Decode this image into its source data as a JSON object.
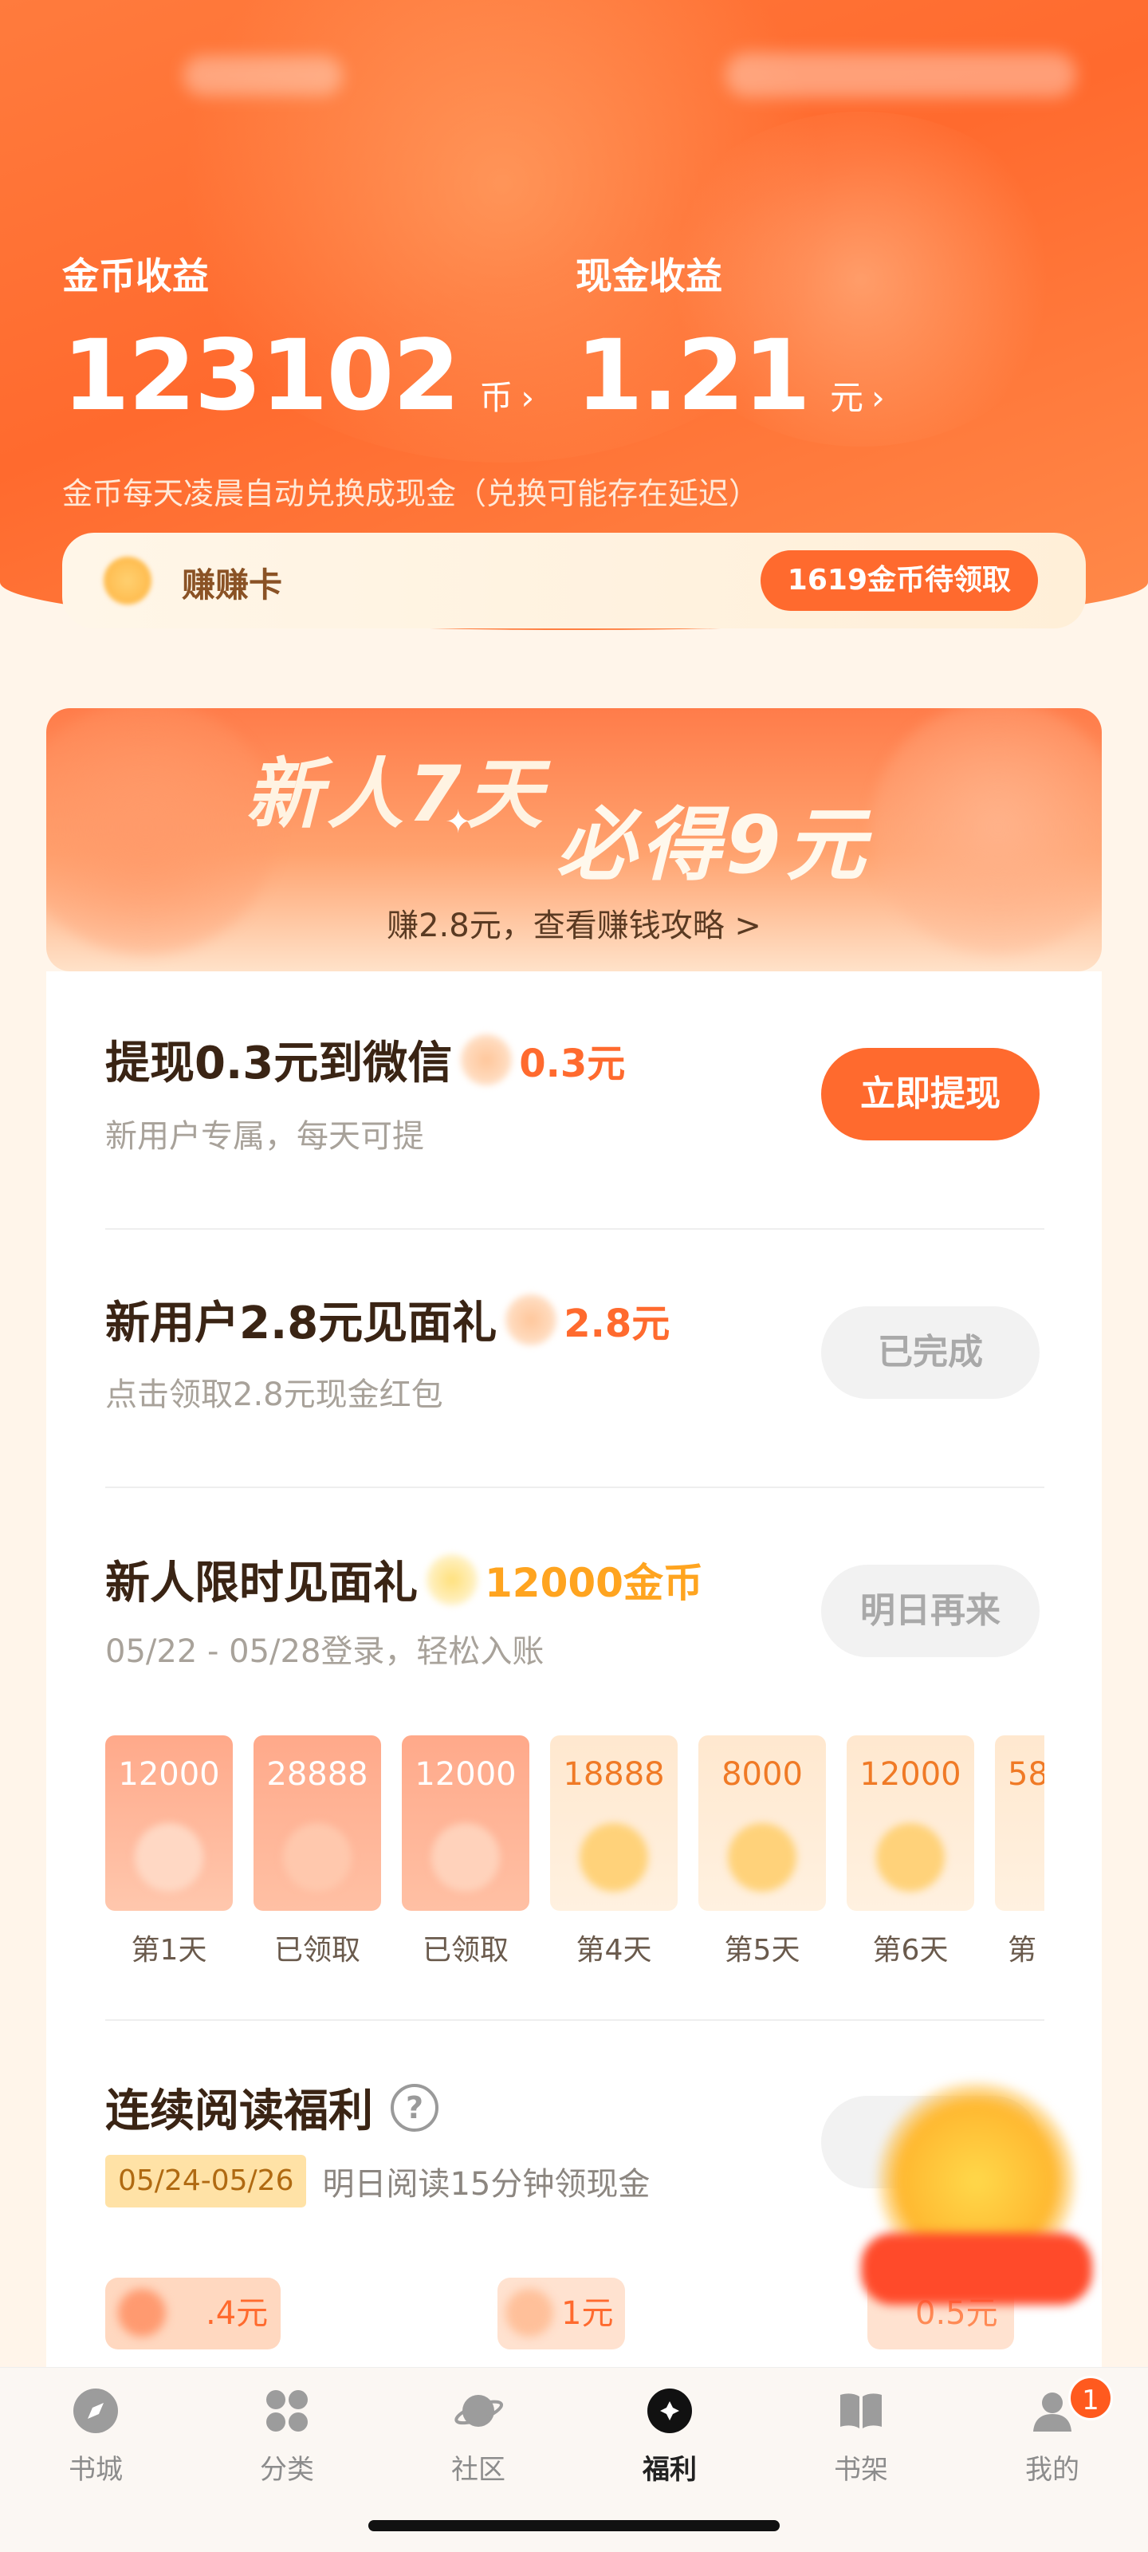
{
  "header": {
    "coin_label": "金币收益",
    "coin_value": "123102",
    "coin_unit": "币",
    "cash_label": "现金收益",
    "cash_value": "1.21",
    "cash_unit": "元",
    "chevron": "›",
    "note": "金币每天凌晨自动兑换成现金（兑换可能存在延迟）"
  },
  "earn_card": {
    "label": "赚赚卡",
    "pill": "1619金币待领取"
  },
  "banner": {
    "line1": "新人7天",
    "line2": "必得9元",
    "sub": "赚2.8元，查看赚钱攻略 >"
  },
  "tasks": [
    {
      "title": "提现0.3元到微信",
      "reward": "0.3元",
      "sub": "新用户专属，每天可提",
      "button": "立即提现"
    },
    {
      "title": "新用户2.8元见面礼",
      "reward": "2.8元",
      "sub": "点击领取2.8元现金红包",
      "button": "已完成"
    },
    {
      "title": "新人限时见面礼",
      "reward": "12000金币",
      "sub": "05/22 - 05/28登录，轻松入账",
      "button": "明日再来"
    }
  ],
  "days": [
    {
      "value": "12000",
      "label": "第1天",
      "state": "claimed"
    },
    {
      "value": "28888",
      "label": "已领取",
      "state": "claimed"
    },
    {
      "value": "12000",
      "label": "已领取",
      "state": "claimed"
    },
    {
      "value": "18888",
      "label": "第4天",
      "state": "future"
    },
    {
      "value": "8000",
      "label": "第5天",
      "state": "future"
    },
    {
      "value": "12000",
      "label": "第6天",
      "state": "future"
    },
    {
      "value": "58",
      "label": "第",
      "state": "future"
    }
  ],
  "reading": {
    "title": "连续阅读福利",
    "help": "?",
    "date": "05/24-05/26",
    "desc": "明日阅读15分钟领现金",
    "rewards": [
      ".4元",
      "1元",
      "0.5元"
    ]
  },
  "tabbar": [
    {
      "label": "书城",
      "icon": "compass-icon"
    },
    {
      "label": "分类",
      "icon": "grid-icon"
    },
    {
      "label": "社区",
      "icon": "planet-icon"
    },
    {
      "label": "福利",
      "icon": "gift-icon",
      "active": true
    },
    {
      "label": "书架",
      "icon": "book-icon"
    },
    {
      "label": "我的",
      "icon": "user-icon",
      "badge": "1"
    }
  ],
  "colors": {
    "accent": "#ff6a2e",
    "gold": "#ffa41f",
    "pale": "#fff5ea"
  }
}
